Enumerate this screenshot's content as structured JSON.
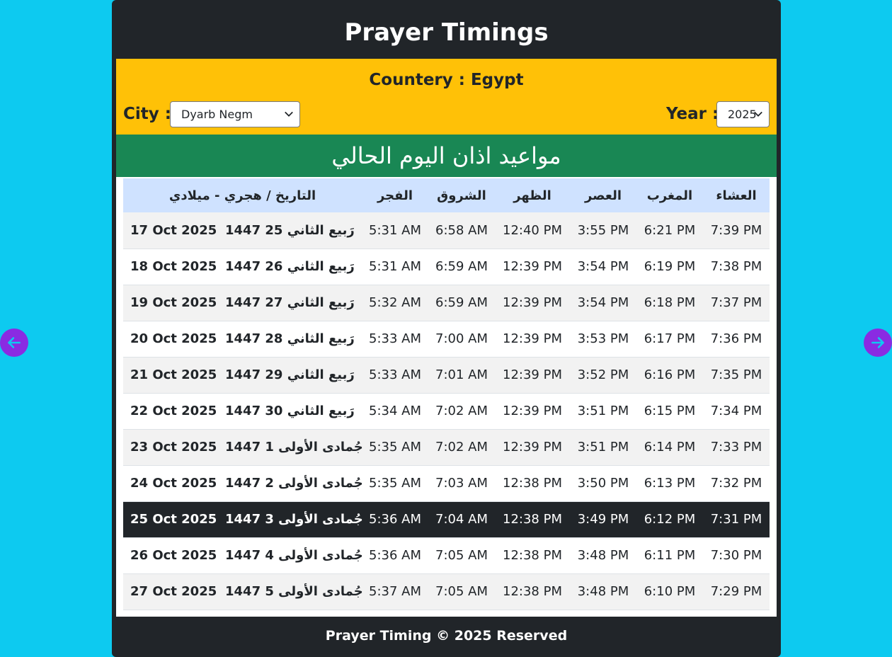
{
  "header": {
    "title": "Prayer Timings"
  },
  "controls": {
    "country_text": "Countery : Egypt",
    "city_label": "City :",
    "city_value": "Dyarb Negm",
    "year_label": "Year :",
    "year_value": "2025"
  },
  "banner": {
    "text": "مواعيد اذان اليوم الحالي"
  },
  "table": {
    "headers": {
      "date": "التاريخ / هجري - ميلادي",
      "fajr": "الفجر",
      "sunrise": "الشروق",
      "dhuhr": "الظهر",
      "asr": "العصر",
      "maghrib": "المغرب",
      "isha": "العشاء"
    },
    "rows": [
      {
        "greg": "17 Oct 2025",
        "hijri": "1447 رَبيع الثاني 25",
        "fajr": "5:31 AM",
        "sunrise": "6:58 AM",
        "dhuhr": "12:40 PM",
        "asr": "3:55 PM",
        "maghrib": "6:21 PM",
        "isha": "7:39 PM"
      },
      {
        "greg": "18 Oct 2025",
        "hijri": "1447 رَبيع الثاني 26",
        "fajr": "5:31 AM",
        "sunrise": "6:59 AM",
        "dhuhr": "12:39 PM",
        "asr": "3:54 PM",
        "maghrib": "6:19 PM",
        "isha": "7:38 PM"
      },
      {
        "greg": "19 Oct 2025",
        "hijri": "1447 رَبيع الثاني 27",
        "fajr": "5:32 AM",
        "sunrise": "6:59 AM",
        "dhuhr": "12:39 PM",
        "asr": "3:54 PM",
        "maghrib": "6:18 PM",
        "isha": "7:37 PM"
      },
      {
        "greg": "20 Oct 2025",
        "hijri": "1447 رَبيع الثاني 28",
        "fajr": "5:33 AM",
        "sunrise": "7:00 AM",
        "dhuhr": "12:39 PM",
        "asr": "3:53 PM",
        "maghrib": "6:17 PM",
        "isha": "7:36 PM"
      },
      {
        "greg": "21 Oct 2025",
        "hijri": "1447 رَبيع الثاني 29",
        "fajr": "5:33 AM",
        "sunrise": "7:01 AM",
        "dhuhr": "12:39 PM",
        "asr": "3:52 PM",
        "maghrib": "6:16 PM",
        "isha": "7:35 PM"
      },
      {
        "greg": "22 Oct 2025",
        "hijri": "1447 رَبيع الثاني 30",
        "fajr": "5:34 AM",
        "sunrise": "7:02 AM",
        "dhuhr": "12:39 PM",
        "asr": "3:51 PM",
        "maghrib": "6:15 PM",
        "isha": "7:34 PM"
      },
      {
        "greg": "23 Oct 2025",
        "hijri": "1447 جُمادى الأولى 1",
        "fajr": "5:35 AM",
        "sunrise": "7:02 AM",
        "dhuhr": "12:39 PM",
        "asr": "3:51 PM",
        "maghrib": "6:14 PM",
        "isha": "7:33 PM"
      },
      {
        "greg": "24 Oct 2025",
        "hijri": "1447 جُمادى الأولى 2",
        "fajr": "5:35 AM",
        "sunrise": "7:03 AM",
        "dhuhr": "12:38 PM",
        "asr": "3:50 PM",
        "maghrib": "6:13 PM",
        "isha": "7:32 PM"
      },
      {
        "greg": "25 Oct 2025",
        "hijri": "1447 جُمادى الأولى 3",
        "fajr": "5:36 AM",
        "sunrise": "7:04 AM",
        "dhuhr": "12:38 PM",
        "asr": "3:49 PM",
        "maghrib": "6:12 PM",
        "isha": "7:31 PM",
        "today": true
      },
      {
        "greg": "26 Oct 2025",
        "hijri": "1447 جُمادى الأولى 4",
        "fajr": "5:36 AM",
        "sunrise": "7:05 AM",
        "dhuhr": "12:38 PM",
        "asr": "3:48 PM",
        "maghrib": "6:11 PM",
        "isha": "7:30 PM"
      },
      {
        "greg": "27 Oct 2025",
        "hijri": "1447 جُمادى الأولى 5",
        "fajr": "5:37 AM",
        "sunrise": "7:05 AM",
        "dhuhr": "12:38 PM",
        "asr": "3:48 PM",
        "maghrib": "6:10 PM",
        "isha": "7:29 PM"
      }
    ]
  },
  "footer": {
    "text": "Prayer Timing © 2025 Reserved"
  },
  "nav": {
    "prev_icon": "arrow-left-icon",
    "next_icon": "arrow-right-icon"
  },
  "colors": {
    "page_background": "#0dcaf0",
    "card_background": "#212529",
    "controls_background": "#ffc107",
    "banner_background": "#198754",
    "header_row_background": "#cfe2ff",
    "nav_button": "#8a2be2"
  }
}
